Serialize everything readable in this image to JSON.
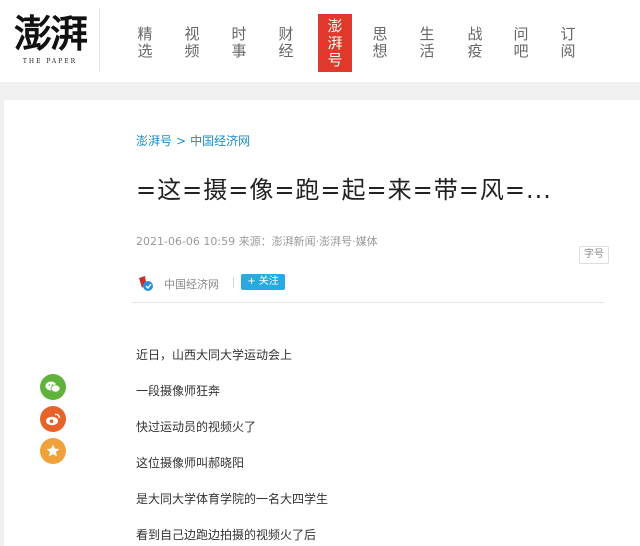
{
  "header": {
    "logo_text": "澎湃",
    "logo_sub": "THE PAPER",
    "nav": [
      {
        "label": [
          "精",
          "选"
        ],
        "active": false
      },
      {
        "label": [
          "视",
          "频"
        ],
        "active": false
      },
      {
        "label": [
          "时",
          "事"
        ],
        "active": false
      },
      {
        "label": [
          "财",
          "经"
        ],
        "active": false
      },
      {
        "label": [
          "澎",
          "湃",
          "号"
        ],
        "active": true
      },
      {
        "label": [
          "思",
          "想"
        ],
        "active": false
      },
      {
        "label": [
          "生",
          "活"
        ],
        "active": false
      },
      {
        "label": [
          "战",
          "疫"
        ],
        "active": false
      },
      {
        "label": [
          "问",
          "吧"
        ],
        "active": false
      },
      {
        "label": [
          "订",
          "阅"
        ],
        "active": false
      }
    ]
  },
  "article": {
    "breadcrumb": {
      "section": "澎湃号",
      "separator": ">",
      "source": "中国经济网"
    },
    "title": "=这=摄=像=跑=起=来=带=风=...",
    "meta": "2021-06-06 10:59 来源：澎湃新闻·澎湃号·媒体",
    "font_size_label": "字号",
    "author": {
      "name": "中国经济网",
      "follow_label": "+ 关注"
    },
    "paragraphs": [
      "近日，山西大同大学运动会上",
      "一段摄像师狂奔",
      "快过运动员的视频火了",
      "这位摄像师叫郝晓阳",
      "是大同大学体育学院的一名大四学生",
      "看到自己边跑边拍摄的视频火了后"
    ]
  },
  "share": {
    "buttons": [
      {
        "icon": "wechat-icon",
        "color": "#5fb33c"
      },
      {
        "icon": "weibo-icon",
        "color": "#e5632a"
      },
      {
        "icon": "star-icon",
        "color": "#f0a23a"
      }
    ]
  },
  "colors": {
    "accent_red": "#e0382b",
    "link_blue": "#1a8bc8",
    "follow_blue": "#2aa8e0"
  }
}
